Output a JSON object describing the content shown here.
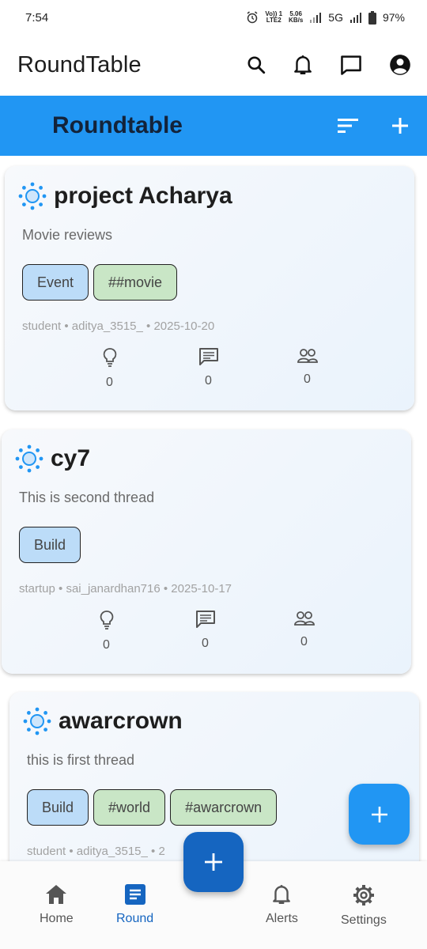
{
  "status_bar": {
    "time": "7:54",
    "volte_line1": "Vo)) 1",
    "volte_line2": "LTE2",
    "speed_line1": "5.06",
    "speed_line2": "KB/s",
    "network": "5G",
    "battery": "97%"
  },
  "app_bar": {
    "title": "RoundTable",
    "icons": [
      "search-icon",
      "bell-icon",
      "chat-icon",
      "account-icon"
    ]
  },
  "header": {
    "title": "Roundtable",
    "icons": [
      "sort-icon",
      "add-icon"
    ]
  },
  "threads": [
    {
      "title": "project Acharya",
      "description": "Movie reviews",
      "tags": [
        {
          "label": "Event",
          "color": "#bcdcf8"
        },
        {
          "label": "##movie",
          "color": "#c9e6c6"
        }
      ],
      "meta": "student • aditya_3515_ • 2025-10-20",
      "stats": {
        "ideas": "0",
        "comments": "0",
        "members": "0"
      }
    },
    {
      "title": "cy7",
      "description": "This is second thread",
      "tags": [
        {
          "label": "Build",
          "color": "#bcdcf8"
        }
      ],
      "meta": "startup • sai_janardhan716 • 2025-10-17",
      "stats": {
        "ideas": "0",
        "comments": "0",
        "members": "0"
      }
    },
    {
      "title": "awarcrown",
      "description": "this is first thread",
      "tags": [
        {
          "label": "Build",
          "color": "#bcdcf8"
        },
        {
          "label": "#world",
          "color": "#c9e6c6"
        },
        {
          "label": "#awarcrown",
          "color": "#c9e6c6"
        }
      ],
      "meta": "student • aditya_3515_ • 2"
    }
  ],
  "bottom_nav": {
    "items": [
      {
        "label": "Home",
        "icon": "home-icon"
      },
      {
        "label": "Round",
        "icon": "round-icon",
        "active": true
      },
      {
        "label": "Alerts",
        "icon": "bell-icon"
      },
      {
        "label": "Settings",
        "icon": "gear-icon"
      }
    ]
  },
  "colors": {
    "primary": "#2196f3",
    "primary_dark": "#1565c0",
    "tag_blue": "#bcdcf8",
    "tag_green": "#c9e6c6"
  }
}
